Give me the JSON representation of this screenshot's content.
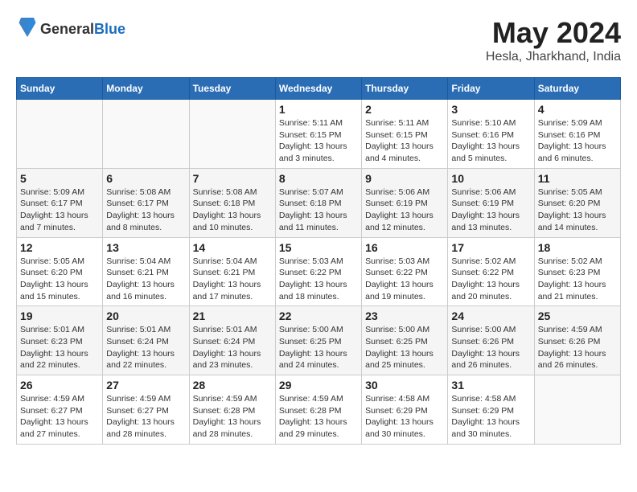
{
  "header": {
    "logo_line1": "General",
    "logo_line2": "Blue",
    "month": "May 2024",
    "location": "Hesla, Jharkhand, India"
  },
  "weekdays": [
    "Sunday",
    "Monday",
    "Tuesday",
    "Wednesday",
    "Thursday",
    "Friday",
    "Saturday"
  ],
  "weeks": [
    [
      {
        "day": "",
        "info": ""
      },
      {
        "day": "",
        "info": ""
      },
      {
        "day": "",
        "info": ""
      },
      {
        "day": "1",
        "info": "Sunrise: 5:11 AM\nSunset: 6:15 PM\nDaylight: 13 hours and 3 minutes."
      },
      {
        "day": "2",
        "info": "Sunrise: 5:11 AM\nSunset: 6:15 PM\nDaylight: 13 hours and 4 minutes."
      },
      {
        "day": "3",
        "info": "Sunrise: 5:10 AM\nSunset: 6:16 PM\nDaylight: 13 hours and 5 minutes."
      },
      {
        "day": "4",
        "info": "Sunrise: 5:09 AM\nSunset: 6:16 PM\nDaylight: 13 hours and 6 minutes."
      }
    ],
    [
      {
        "day": "5",
        "info": "Sunrise: 5:09 AM\nSunset: 6:17 PM\nDaylight: 13 hours and 7 minutes."
      },
      {
        "day": "6",
        "info": "Sunrise: 5:08 AM\nSunset: 6:17 PM\nDaylight: 13 hours and 8 minutes."
      },
      {
        "day": "7",
        "info": "Sunrise: 5:08 AM\nSunset: 6:18 PM\nDaylight: 13 hours and 10 minutes."
      },
      {
        "day": "8",
        "info": "Sunrise: 5:07 AM\nSunset: 6:18 PM\nDaylight: 13 hours and 11 minutes."
      },
      {
        "day": "9",
        "info": "Sunrise: 5:06 AM\nSunset: 6:19 PM\nDaylight: 13 hours and 12 minutes."
      },
      {
        "day": "10",
        "info": "Sunrise: 5:06 AM\nSunset: 6:19 PM\nDaylight: 13 hours and 13 minutes."
      },
      {
        "day": "11",
        "info": "Sunrise: 5:05 AM\nSunset: 6:20 PM\nDaylight: 13 hours and 14 minutes."
      }
    ],
    [
      {
        "day": "12",
        "info": "Sunrise: 5:05 AM\nSunset: 6:20 PM\nDaylight: 13 hours and 15 minutes."
      },
      {
        "day": "13",
        "info": "Sunrise: 5:04 AM\nSunset: 6:21 PM\nDaylight: 13 hours and 16 minutes."
      },
      {
        "day": "14",
        "info": "Sunrise: 5:04 AM\nSunset: 6:21 PM\nDaylight: 13 hours and 17 minutes."
      },
      {
        "day": "15",
        "info": "Sunrise: 5:03 AM\nSunset: 6:22 PM\nDaylight: 13 hours and 18 minutes."
      },
      {
        "day": "16",
        "info": "Sunrise: 5:03 AM\nSunset: 6:22 PM\nDaylight: 13 hours and 19 minutes."
      },
      {
        "day": "17",
        "info": "Sunrise: 5:02 AM\nSunset: 6:22 PM\nDaylight: 13 hours and 20 minutes."
      },
      {
        "day": "18",
        "info": "Sunrise: 5:02 AM\nSunset: 6:23 PM\nDaylight: 13 hours and 21 minutes."
      }
    ],
    [
      {
        "day": "19",
        "info": "Sunrise: 5:01 AM\nSunset: 6:23 PM\nDaylight: 13 hours and 22 minutes."
      },
      {
        "day": "20",
        "info": "Sunrise: 5:01 AM\nSunset: 6:24 PM\nDaylight: 13 hours and 22 minutes."
      },
      {
        "day": "21",
        "info": "Sunrise: 5:01 AM\nSunset: 6:24 PM\nDaylight: 13 hours and 23 minutes."
      },
      {
        "day": "22",
        "info": "Sunrise: 5:00 AM\nSunset: 6:25 PM\nDaylight: 13 hours and 24 minutes."
      },
      {
        "day": "23",
        "info": "Sunrise: 5:00 AM\nSunset: 6:25 PM\nDaylight: 13 hours and 25 minutes."
      },
      {
        "day": "24",
        "info": "Sunrise: 5:00 AM\nSunset: 6:26 PM\nDaylight: 13 hours and 26 minutes."
      },
      {
        "day": "25",
        "info": "Sunrise: 4:59 AM\nSunset: 6:26 PM\nDaylight: 13 hours and 26 minutes."
      }
    ],
    [
      {
        "day": "26",
        "info": "Sunrise: 4:59 AM\nSunset: 6:27 PM\nDaylight: 13 hours and 27 minutes."
      },
      {
        "day": "27",
        "info": "Sunrise: 4:59 AM\nSunset: 6:27 PM\nDaylight: 13 hours and 28 minutes."
      },
      {
        "day": "28",
        "info": "Sunrise: 4:59 AM\nSunset: 6:28 PM\nDaylight: 13 hours and 28 minutes."
      },
      {
        "day": "29",
        "info": "Sunrise: 4:59 AM\nSunset: 6:28 PM\nDaylight: 13 hours and 29 minutes."
      },
      {
        "day": "30",
        "info": "Sunrise: 4:58 AM\nSunset: 6:29 PM\nDaylight: 13 hours and 30 minutes."
      },
      {
        "day": "31",
        "info": "Sunrise: 4:58 AM\nSunset: 6:29 PM\nDaylight: 13 hours and 30 minutes."
      },
      {
        "day": "",
        "info": ""
      }
    ]
  ]
}
